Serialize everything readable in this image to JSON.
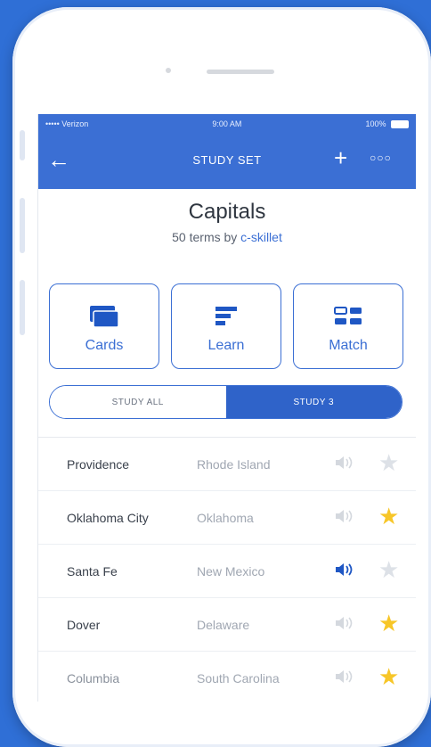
{
  "status_bar": {
    "carrier": "••••• Verizon",
    "time": "9:00 AM",
    "battery": "100%"
  },
  "nav": {
    "back_icon": "back-arrow-icon",
    "title": "STUDY SET",
    "add_icon": "plus-icon",
    "more_icon": "more-dots-icon"
  },
  "set": {
    "title": "Capitals",
    "subtitle_prefix": "50 terms by",
    "author": "c-skillet"
  },
  "modes": [
    {
      "label": "Cards",
      "icon": "cards-icon"
    },
    {
      "label": "Learn",
      "icon": "learn-icon"
    },
    {
      "label": "Match",
      "icon": "match-icon"
    }
  ],
  "toggle": {
    "all_label": "STUDY ALL",
    "selected_label": "STUDY 3",
    "selected": "STUDY 3"
  },
  "terms": [
    {
      "term": "Providence",
      "definition": "Rhode Island",
      "audio_active": false,
      "starred": false
    },
    {
      "term": "Oklahoma City",
      "definition": "Oklahoma",
      "audio_active": false,
      "starred": true
    },
    {
      "term": "Santa Fe",
      "definition": "New Mexico",
      "audio_active": true,
      "starred": false
    },
    {
      "term": "Dover",
      "definition": "Delaware",
      "audio_active": false,
      "starred": true
    },
    {
      "term": "Columbia",
      "definition": "South Carolina",
      "audio_active": false,
      "starred": true
    }
  ],
  "colors": {
    "accent": "#3b6fd4",
    "star_on": "#f7c628",
    "star_off": "#dde1e7",
    "background": "#2f6fd6"
  }
}
